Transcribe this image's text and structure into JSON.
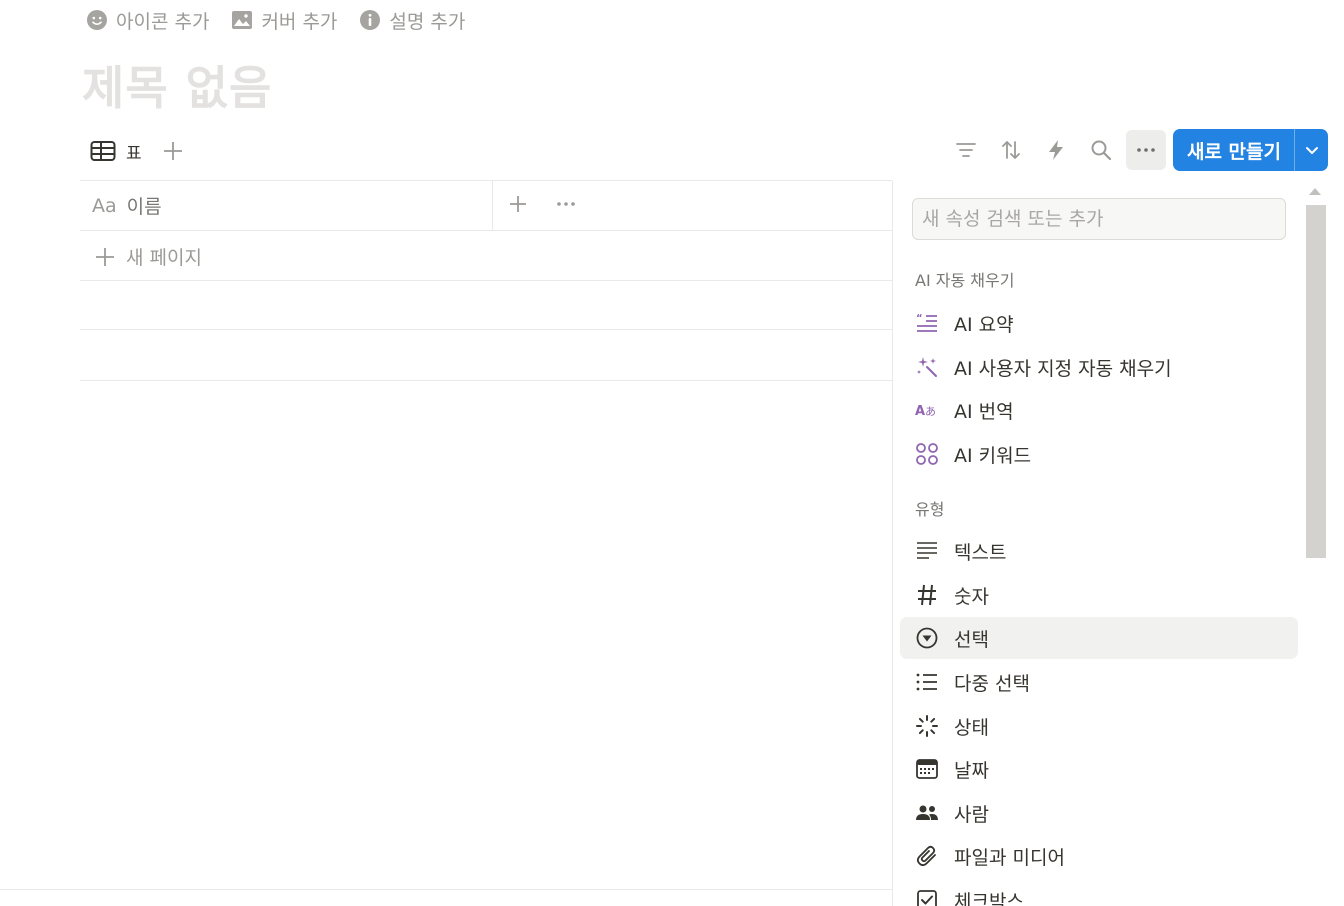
{
  "page_actions": {
    "add_icon": "아이콘 추가",
    "add_cover": "커버 추가",
    "add_description": "설명 추가"
  },
  "page": {
    "title_placeholder": "제목 없음"
  },
  "views": {
    "tabs": [
      {
        "label": "표",
        "icon": "table-icon"
      }
    ]
  },
  "toolbar": {
    "icons": [
      "filter-icon",
      "sort-icon",
      "automation-icon",
      "search-icon",
      "more-icon"
    ],
    "new_button_label": "새로 만들기",
    "accent_color": "#2383e2"
  },
  "table": {
    "name_column_prefix": "Aa",
    "name_column": "이름",
    "new_page": "새 페이지"
  },
  "property_menu": {
    "search_placeholder": "새 속성 검색 또는 추가",
    "ai_section": "AI 자동 채우기",
    "ai_items": [
      {
        "label": "AI 요약",
        "icon": "ai-summary-icon"
      },
      {
        "label": "AI 사용자 지정 자동 채우기",
        "icon": "ai-sparkle-icon"
      },
      {
        "label": "AI 번역",
        "icon": "ai-translate-icon"
      },
      {
        "label": "AI 키워드",
        "icon": "ai-keywords-icon"
      }
    ],
    "type_section": "유형",
    "type_items": [
      {
        "label": "텍스트",
        "icon": "text-lines-icon"
      },
      {
        "label": "숫자",
        "icon": "hash-icon"
      },
      {
        "label": "선택",
        "icon": "select-circle-icon"
      },
      {
        "label": "다중 선택",
        "icon": "list-icon"
      },
      {
        "label": "상태",
        "icon": "status-spinner-icon"
      },
      {
        "label": "날짜",
        "icon": "calendar-icon"
      },
      {
        "label": "사람",
        "icon": "people-icon"
      },
      {
        "label": "파일과 미디어",
        "icon": "paperclip-icon"
      },
      {
        "label": "체크박스",
        "icon": "checkbox-icon"
      }
    ],
    "ai_icon_color": "#9065b0"
  }
}
